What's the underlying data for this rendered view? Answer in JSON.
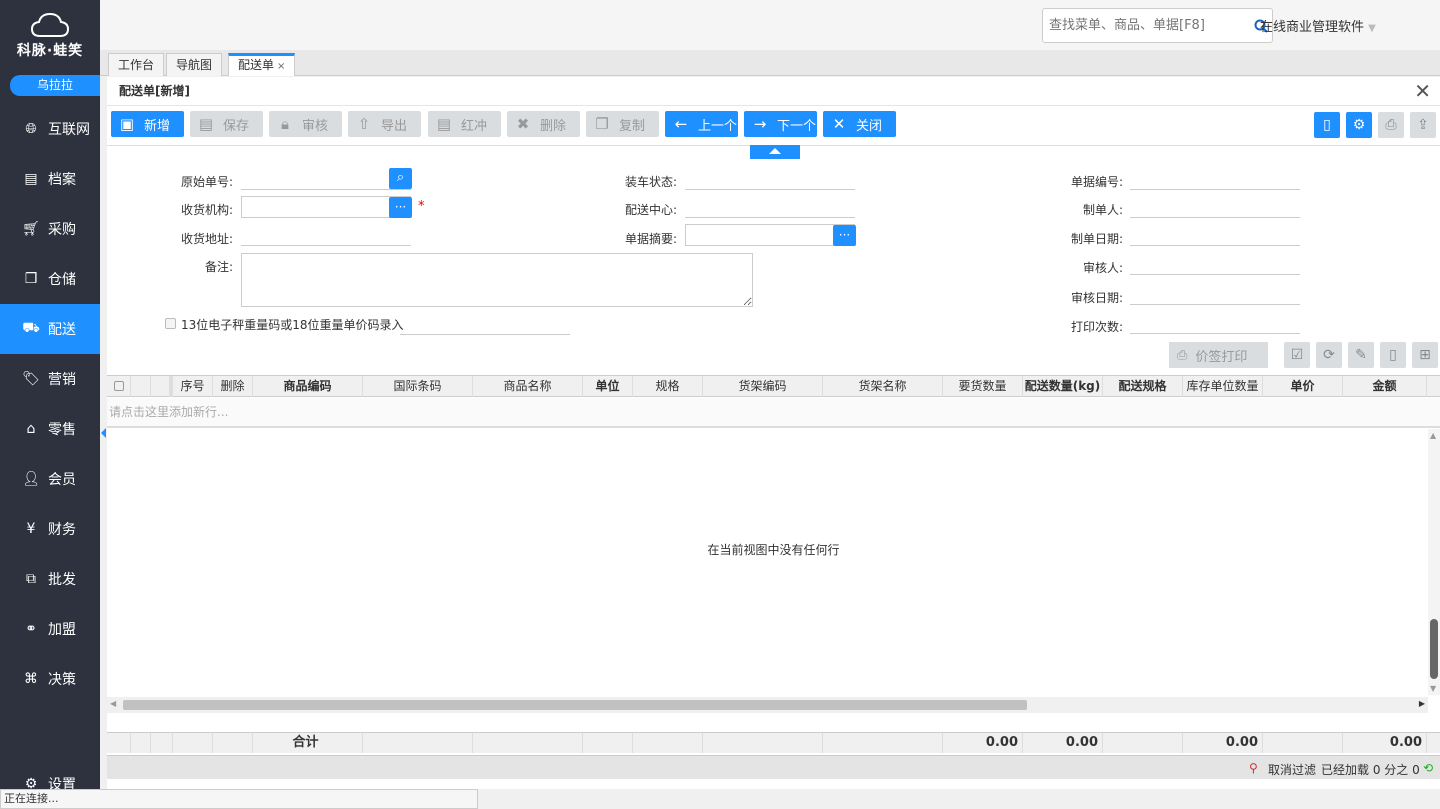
{
  "app": {
    "logo_text": "科脉·蛙笑",
    "user": "乌拉拉",
    "brand": "在线商业管理软件"
  },
  "search": {
    "placeholder": "查找菜单、商品、单据[F8]"
  },
  "nav": [
    {
      "label": "互联网",
      "icon": "globe-icon",
      "active": false
    },
    {
      "label": "档案",
      "icon": "file-icon",
      "active": false
    },
    {
      "label": "采购",
      "icon": "cart-icon",
      "active": false
    },
    {
      "label": "仓储",
      "icon": "box-icon",
      "active": false
    },
    {
      "label": "配送",
      "icon": "truck-icon",
      "active": true
    },
    {
      "label": "营销",
      "icon": "tag-icon",
      "active": false
    },
    {
      "label": "零售",
      "icon": "basket-icon",
      "active": false
    },
    {
      "label": "会员",
      "icon": "user-icon",
      "active": false
    },
    {
      "label": "财务",
      "icon": "yen-icon",
      "active": false
    },
    {
      "label": "批发",
      "icon": "layers-icon",
      "active": false
    },
    {
      "label": "加盟",
      "icon": "rings-icon",
      "active": false
    },
    {
      "label": "决策",
      "icon": "briefcase-icon",
      "active": false
    }
  ],
  "settings_label": "设置",
  "tabs": [
    {
      "label": "工作台"
    },
    {
      "label": "导航图"
    },
    {
      "label": "配送单",
      "close": "×"
    }
  ],
  "panel": {
    "title": "配送单[新增]",
    "close": "✕"
  },
  "toolbar": [
    {
      "label": "新增",
      "enabled": true
    },
    {
      "label": "保存",
      "enabled": false
    },
    {
      "label": "审核",
      "enabled": false
    },
    {
      "label": "导出",
      "enabled": false
    },
    {
      "label": "红冲",
      "enabled": false
    },
    {
      "label": "删除",
      "enabled": false
    },
    {
      "label": "复制",
      "enabled": false
    },
    {
      "label": "上一个",
      "enabled": true
    },
    {
      "label": "下一个",
      "enabled": true
    },
    {
      "label": "关闭",
      "enabled": true
    }
  ],
  "form": {
    "original_no": "原始单号:",
    "receiver_org": "收货机构:",
    "receiver_addr": "收货地址:",
    "remark": "备注:",
    "loading_status": "装车状态:",
    "dist_center": "配送中心:",
    "summary": "单据摘要:",
    "doc_no": "单据编号:",
    "creator": "制单人:",
    "create_date": "制单日期:",
    "auditor": "审核人:",
    "audit_date": "审核日期:",
    "print_count": "打印次数:",
    "barcode_option": "13位电子秤重量码或18位重量单价码录入",
    "required": "*"
  },
  "price_print": "价签打印",
  "grid": {
    "columns": [
      "",
      "",
      "",
      "序号",
      "删除",
      "商品编码",
      "国际条码",
      "商品名称",
      "单位",
      "规格",
      "货架编码",
      "货架名称",
      "要货数量",
      "配送数量(kg)",
      "配送规格",
      "库存单位数量",
      "单价",
      "金额"
    ],
    "add_row_hint": "请点击这里添加新行...",
    "empty_text": "在当前视图中没有任何行",
    "total_label": "合计",
    "totals": {
      "req_qty": "0.00",
      "dist_qty": "0.00",
      "stock_qty": "0.00",
      "amount": "0.00"
    }
  },
  "status": {
    "cancel_filter": "取消过滤",
    "loaded": "已经加载 0 分之 0"
  },
  "connection": "正在连接..."
}
